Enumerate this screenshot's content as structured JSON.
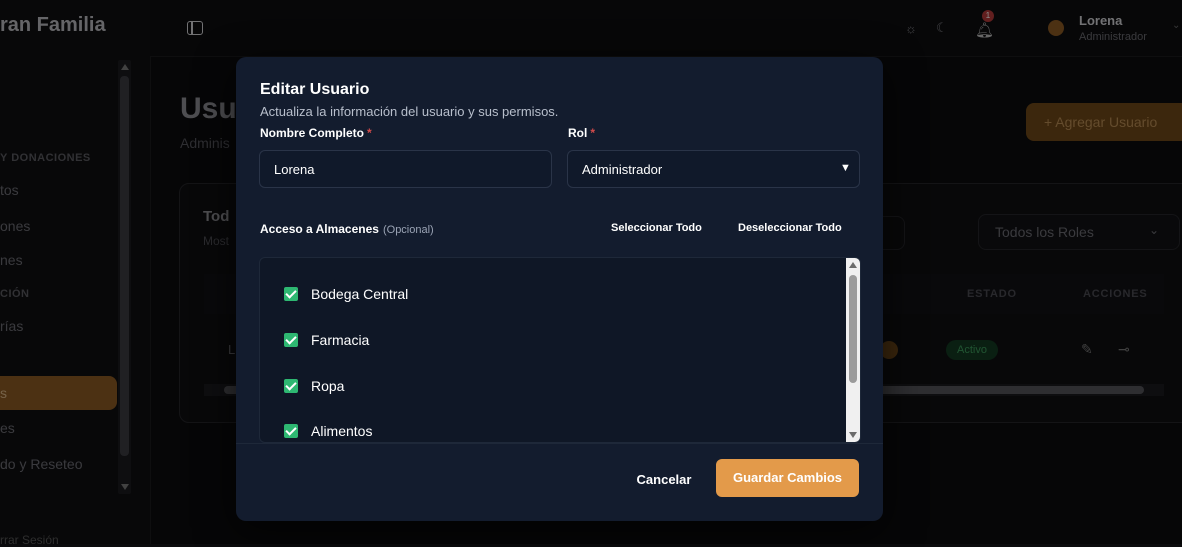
{
  "colors": {
    "accent": "#e39a4a",
    "checkbox": "#2eb872",
    "modal_bg": "#131c2e",
    "required": "#d24b4b"
  },
  "app": {
    "brand": "ran Familia",
    "sidebar": {
      "sections": [
        "Y DONACIONES",
        "CIÓN"
      ],
      "items": [
        "tos",
        "ones",
        "nes",
        "rías",
        "s",
        "es",
        "do y Reseteo"
      ],
      "logout": "rrar Sesión"
    },
    "topbar": {
      "icons": [
        "panel-toggle-icon",
        "sun-icon",
        "moon-icon",
        "bell-icon"
      ],
      "notification_count": "1",
      "user_name": "Lorena",
      "user_role": "Administrador"
    },
    "page": {
      "title": "Usu",
      "subtitle": "Adminis",
      "add_button": "+ Agregar Usuario"
    },
    "card": {
      "title": "Tod",
      "subtitle": "Most",
      "role_filter": "Todos los Roles",
      "columns": [
        "ESTADO",
        "ACCIONES"
      ],
      "row_first": "L",
      "status": "Activo"
    }
  },
  "modal": {
    "title": "Editar Usuario",
    "description": "Actualiza la información del usuario y sus permisos.",
    "name_label": "Nombre Completo",
    "name_value": "Lorena",
    "role_label": "Rol",
    "required_mark": "*",
    "role_value": "Administrador",
    "access_label": "Acceso a Almacenes",
    "access_optional": "(Opcional)",
    "select_all": "Seleccionar Todo",
    "deselect_all": "Deseleccionar Todo",
    "warehouses": [
      {
        "name": "Bodega Central",
        "checked": true
      },
      {
        "name": "Farmacia",
        "checked": true
      },
      {
        "name": "Ropa",
        "checked": true
      },
      {
        "name": "Alimentos",
        "checked": true
      }
    ],
    "cancel": "Cancelar",
    "save": "Guardar Cambios"
  }
}
